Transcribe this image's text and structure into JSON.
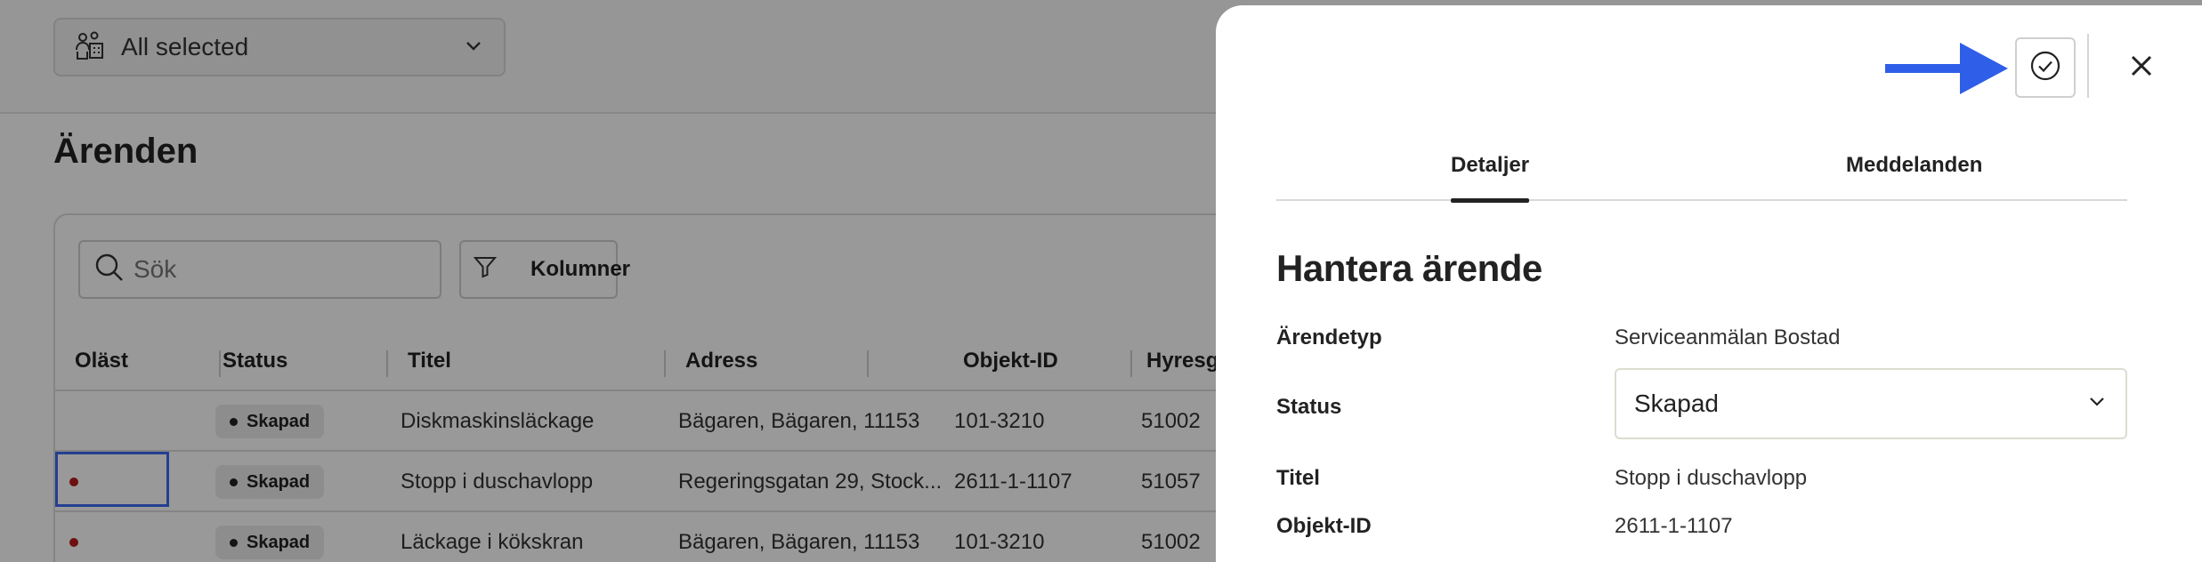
{
  "filter": {
    "label": "All selected"
  },
  "page": {
    "title": "Ärenden"
  },
  "toolbar": {
    "search_placeholder": "Sök",
    "columns_label": "Kolumner"
  },
  "table": {
    "columns": [
      "Oläst",
      "Status",
      "Titel",
      "Adress",
      "Objekt-ID",
      "Hyresg"
    ],
    "rows": [
      {
        "unread": false,
        "status": "Skapad",
        "title": "Diskmaskinsläckage",
        "address": "Bägaren, Bägaren, 11153",
        "object_id": "101-3210",
        "tenant": "51002"
      },
      {
        "unread": true,
        "status": "Skapad",
        "title": "Stopp i duschavlopp",
        "address": "Regeringsgatan 29, Stock...",
        "object_id": "2611-1-1107",
        "tenant": "51057"
      },
      {
        "unread": true,
        "status": "Skapad",
        "title": "Läckage i kökskran",
        "address": "Bägaren, Bägaren, 11153",
        "object_id": "101-3210",
        "tenant": "51002"
      }
    ]
  },
  "panel": {
    "tabs": [
      "Detaljer",
      "Meddelanden"
    ],
    "active_tab": "Detaljer",
    "heading": "Hantera ärende",
    "fields": {
      "case_type_label": "Ärendetyp",
      "case_type_value": "Serviceanmälan Bostad",
      "status_label": "Status",
      "status_value": "Skapad",
      "title_label": "Titel",
      "title_value": "Stopp i duschavlopp",
      "object_id_label": "Objekt-ID",
      "object_id_value": "2611-1-1107"
    }
  },
  "colors": {
    "accent_arrow": "#2f5fe8",
    "unread": "#b71c1c",
    "focus": "#3d6af0"
  }
}
